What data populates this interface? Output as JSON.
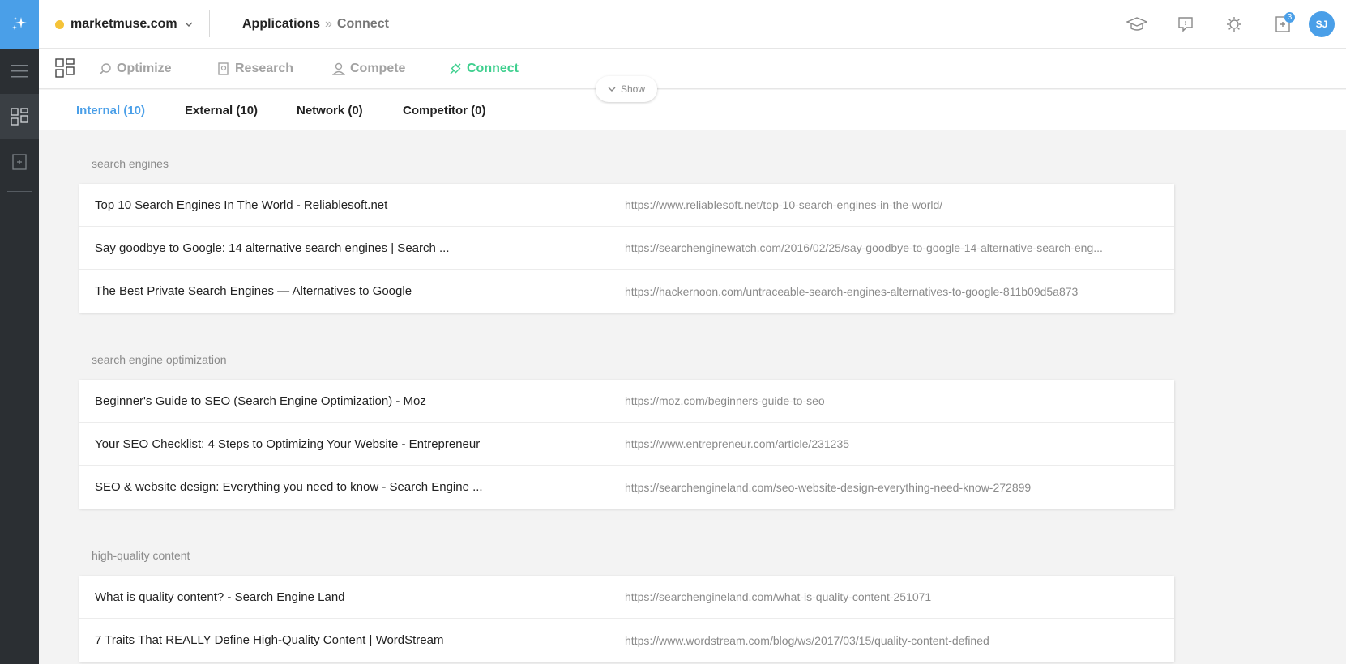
{
  "org": {
    "name": "marketmuse.com"
  },
  "breadcrumb": {
    "parent": "Applications",
    "separator": "»",
    "current": "Connect"
  },
  "header_icons": {
    "notifications_count": "3",
    "avatar_initials": "SJ"
  },
  "apps": [
    {
      "label": "Optimize",
      "icon": "optimize-icon"
    },
    {
      "label": "Research",
      "icon": "research-icon"
    },
    {
      "label": "Compete",
      "icon": "compete-icon"
    },
    {
      "label": "Connect",
      "icon": "connect-icon",
      "active": true
    }
  ],
  "show_toggle": {
    "label": "Show"
  },
  "subtabs": [
    {
      "label": "Internal (10)",
      "active": true
    },
    {
      "label": "External (10)"
    },
    {
      "label": "Network (0)"
    },
    {
      "label": "Competitor (0)"
    }
  ],
  "groups": [
    {
      "title": "search engines",
      "rows": [
        {
          "title": "Top 10 Search Engines In The World - Reliablesoft.net",
          "url": "https://www.reliablesoft.net/top-10-search-engines-in-the-world/"
        },
        {
          "title": "Say goodbye to Google: 14 alternative search engines | Search ...",
          "url": "https://searchenginewatch.com/2016/02/25/say-goodbye-to-google-14-alternative-search-eng..."
        },
        {
          "title": "The Best Private Search Engines — Alternatives to Google",
          "url": "https://hackernoon.com/untraceable-search-engines-alternatives-to-google-811b09d5a873"
        }
      ]
    },
    {
      "title": "search engine optimization",
      "rows": [
        {
          "title": "Beginner's Guide to SEO (Search Engine Optimization) - Moz",
          "url": "https://moz.com/beginners-guide-to-seo"
        },
        {
          "title": "Your SEO Checklist: 4 Steps to Optimizing Your Website - Entrepreneur",
          "url": "https://www.entrepreneur.com/article/231235"
        },
        {
          "title": "SEO & website design: Everything you need to know - Search Engine ...",
          "url": "https://searchengineland.com/seo-website-design-everything-need-know-272899"
        }
      ]
    },
    {
      "title": "high-quality content",
      "rows": [
        {
          "title": "What is quality content? - Search Engine Land",
          "url": "https://searchengineland.com/what-is-quality-content-251071"
        },
        {
          "title": "7 Traits That REALLY Define High-Quality Content | WordStream",
          "url": "https://www.wordstream.com/blog/ws/2017/03/15/quality-content-defined"
        }
      ]
    }
  ],
  "colors": {
    "accent": "#4a9fe8",
    "connect_green": "#3ecf8e",
    "rail": "#2b2f33",
    "org_dot": "#f5c338"
  }
}
